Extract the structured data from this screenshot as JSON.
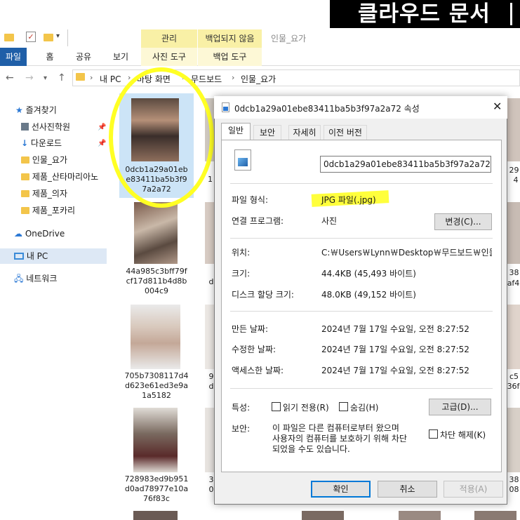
{
  "banner": {
    "text": "클라우드 문서"
  },
  "ribbon": {
    "context_manage": "관리",
    "context_backup": "백업되지 않음",
    "window_title": "인물_요가",
    "tabs": [
      "파일",
      "홈",
      "공유",
      "보기"
    ],
    "context_tabs": [
      "사진 도구",
      "백업 도구"
    ]
  },
  "address": {
    "crumbs": [
      "내 PC",
      "바탕 화면",
      "무드보드",
      "인물_요가"
    ]
  },
  "nav": {
    "items": [
      {
        "label": "즐겨찾기",
        "icon": "star-icon"
      },
      {
        "label": "선사진학원",
        "icon": "image-folder-icon"
      },
      {
        "label": "다운로드",
        "icon": "download-icon"
      },
      {
        "label": "인물_요가",
        "icon": "folder-icon"
      },
      {
        "label": "제품_산타마리아노",
        "icon": "folder-icon"
      },
      {
        "label": "제품_의자",
        "icon": "folder-icon"
      },
      {
        "label": "제품_포카리",
        "icon": "folder-icon"
      },
      {
        "label": "OneDrive",
        "icon": "cloud-icon"
      },
      {
        "label": "내 PC",
        "icon": "pc-icon"
      },
      {
        "label": "네트워크",
        "icon": "network-icon"
      }
    ]
  },
  "files": [
    {
      "name": "0dcb1a29a01ebe83411ba5b3f97a2a72",
      "lines": [
        "0dcb1a29a01eb",
        "e83411ba5b3f9",
        "7a2a72"
      ]
    },
    {
      "name": "44a985c3bff79fcf17d811b4d8b004c9",
      "lines": [
        "44a985c3bff79f",
        "cf17d811b4d8b",
        "004c9"
      ]
    },
    {
      "name": "705b7308117d4d623e61ed3e9a1a5182",
      "lines": [
        "705b7308117d4",
        "d623e61ed3e9a",
        "1a5182"
      ]
    },
    {
      "name": "728983ed9b951d0ad78977e10a76f83c",
      "lines": [
        "728983ed9b951",
        "d0ad78977e10a",
        "76f83c"
      ]
    }
  ],
  "partial_col2": [
    "2",
    "1",
    "",
    "d",
    "",
    "9",
    "d",
    "",
    "3",
    "0"
  ],
  "partial_right": [
    "29",
    "4",
    "",
    "38",
    "af4",
    "",
    "c5",
    "36f",
    "",
    "38",
    "08"
  ],
  "dialog": {
    "title": "0dcb1a29a01ebe83411ba5b3f97a2a72 속성",
    "tabs": [
      "일반",
      "보안",
      "자세히",
      "이전 버전"
    ],
    "filename": "0dcb1a29a01ebe83411ba5b3f97a2a72",
    "type_label": "파일 형식:",
    "type_value": "JPG 파일(.jpg)",
    "open_label": "연결 프로그램:",
    "open_value": "사진",
    "change_btn": "변경(C)...",
    "location_label": "위치:",
    "location_value": "C:￦Users￦Lynn￦Desktop￦무드보드￦인물_요",
    "size_label": "크기:",
    "size_value": "44.4KB (45,493 바이트)",
    "disk_label": "디스크 할당 크기:",
    "disk_value": "48.0KB (49,152 바이트)",
    "created_label": "만든 날짜:",
    "created_value": "2024년 7월 17일 수요일, 오전 8:27:52",
    "modified_label": "수정한 날짜:",
    "modified_value": "2024년 7월 17일 수요일, 오전 8:27:52",
    "accessed_label": "액세스한 날짜:",
    "accessed_value": "2024년 7월 17일 수요일, 오전 8:27:52",
    "attr_label": "특성:",
    "readonly_label": "읽기 전용(R)",
    "hidden_label": "숨김(H)",
    "advanced_btn": "고급(D)...",
    "security_label": "보안:",
    "security_text_1": "이 파일은 다른 컴퓨터로부터 왔으며",
    "security_text_2": "사용자의 컴퓨터를 보호하기 위해 차단",
    "security_text_3": "되었을 수도 있습니다.",
    "unblock_label": "차단 해제(K)",
    "ok_btn": "확인",
    "cancel_btn": "취소",
    "apply_btn": "적용(A)"
  },
  "colors": {
    "highlight": "#ffff24",
    "file_tab": "#1f5fa8",
    "context_band": "#f9f0a6"
  }
}
